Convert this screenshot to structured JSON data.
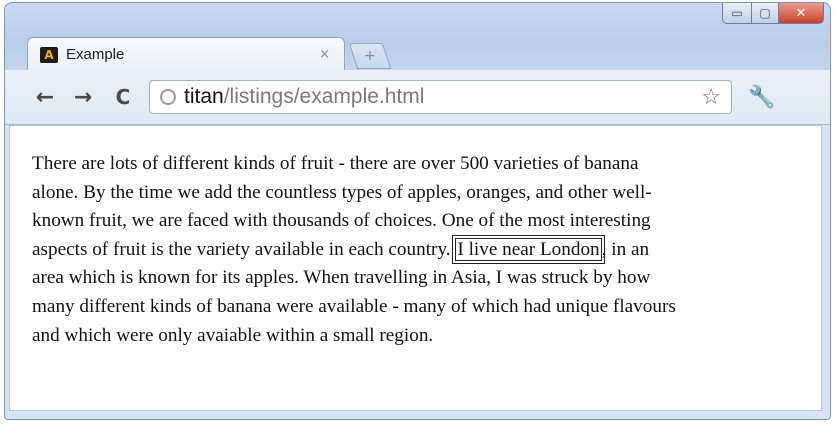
{
  "window": {
    "controls": {
      "minimize": "▭",
      "maximize": "▢",
      "close": "✕"
    }
  },
  "tab": {
    "favicon_letter": "A",
    "title": "Example",
    "close": "×",
    "new_tab": "+"
  },
  "toolbar": {
    "back": "←",
    "forward": "→",
    "reload": "C",
    "url_host": "titan",
    "url_path": "/listings/example.html",
    "bookmark_star": "☆",
    "menu_wrench": "🔧"
  },
  "content": {
    "text_before": "There are lots of different kinds of fruit - there are over 500 varieties of banana\nalone. By the time we add the countless types of apples, oranges, and other well-\nknown fruit, we are faced with thousands of choices. One of the most interesting\naspects of fruit is the variety available in each country. ",
    "highlight": "I live near London",
    "text_after": ", in an\narea which is known for its apples. When travelling in Asia, I was struck by how\nmany different kinds of banana were available - many of which had unique flavours\nand which were only avaiable within a small region."
  }
}
